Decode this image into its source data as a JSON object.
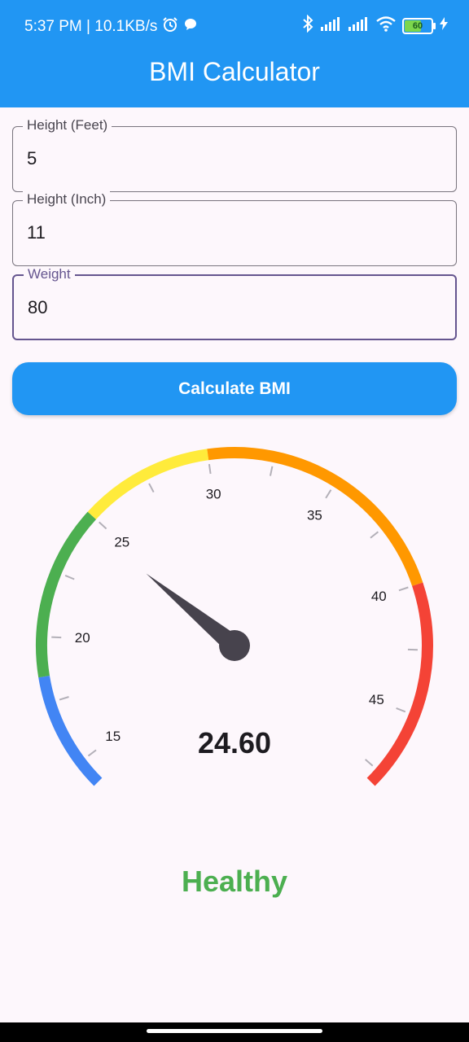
{
  "status_bar": {
    "time_speed": "5:37 PM | 10.1KB/s",
    "battery_level": "60",
    "icons": [
      "alarm-icon",
      "chat-bubble-icon",
      "bluetooth-icon",
      "signal-icon",
      "signal-icon",
      "wifi-icon",
      "battery-icon",
      "charging-bolt-icon"
    ]
  },
  "app_bar": {
    "title": "BMI Calculator",
    "color": "#2196f3"
  },
  "form": {
    "height_feet": {
      "label": "Height (Feet)",
      "value": "5"
    },
    "height_inch": {
      "label": "Height (Inch)",
      "value": "11"
    },
    "weight": {
      "label": "Weight",
      "value": "80"
    }
  },
  "calculate_button": {
    "label": "Calculate BMI"
  },
  "gauge": {
    "min": 14,
    "max": 48,
    "value": 24.6,
    "value_text": "24.60",
    "labels": [
      "15",
      "20",
      "25",
      "30",
      "35",
      "40",
      "45"
    ],
    "ranges": [
      {
        "from": 14,
        "to": 18.5,
        "color": "#4285f4"
      },
      {
        "from": 18.5,
        "to": 25,
        "color": "#4caf50"
      },
      {
        "from": 25,
        "to": 30,
        "color": "#ffeb3b"
      },
      {
        "from": 30,
        "to": 40,
        "color": "#ff9800"
      },
      {
        "from": 40,
        "to": 48,
        "color": "#f44336"
      }
    ]
  },
  "result": {
    "label": "Healthy",
    "color": "#4caf50"
  }
}
